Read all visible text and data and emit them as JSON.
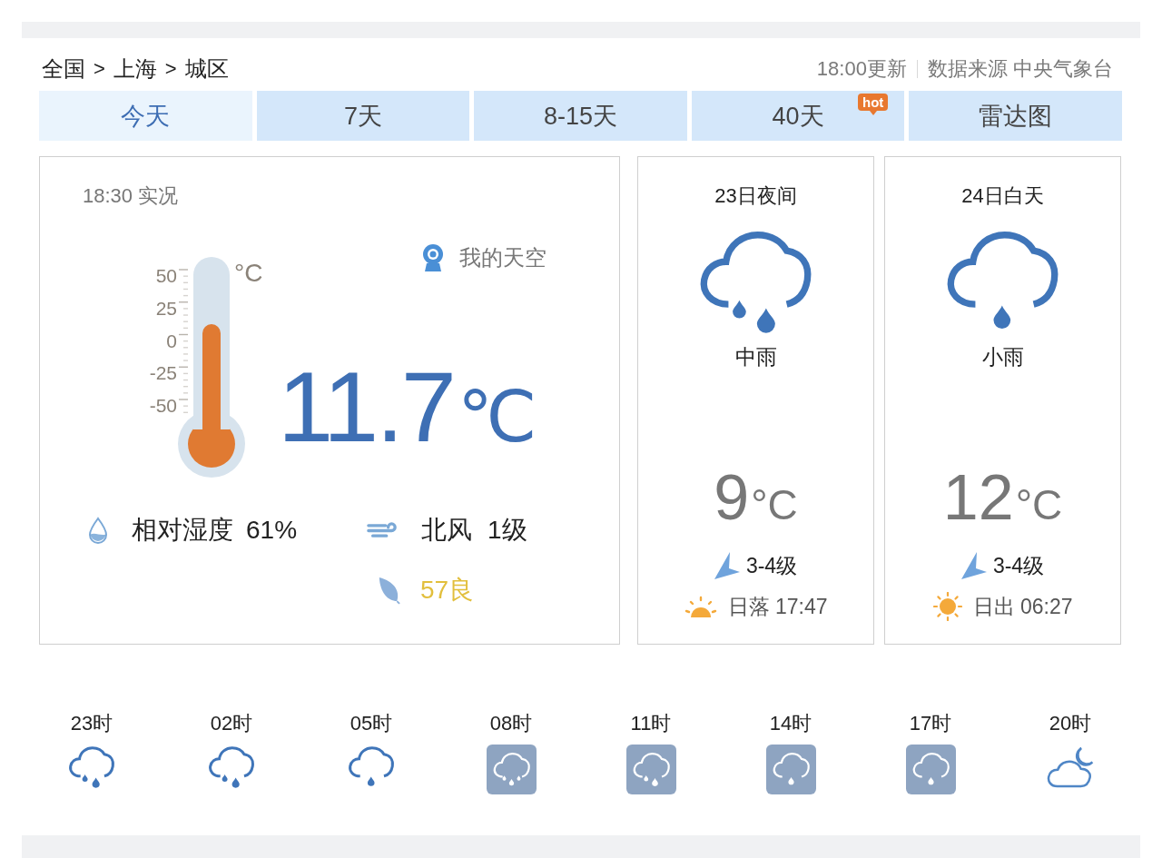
{
  "header": {
    "breadcrumb": [
      {
        "kind": "link",
        "label": "全国"
      },
      {
        "kind": "separator",
        "label": ">"
      },
      {
        "kind": "link",
        "label": "上海"
      },
      {
        "kind": "separator",
        "label": ">"
      },
      {
        "kind": "link",
        "label": "城区"
      }
    ],
    "update_time": "18:00更新",
    "source": "数据来源 中央气象台"
  },
  "tabs": [
    {
      "label": "今天",
      "selected": true
    },
    {
      "label": "7天",
      "selected": false
    },
    {
      "label": "8-15天",
      "selected": false
    },
    {
      "label": "40天",
      "selected": false,
      "badge": "hot"
    },
    {
      "label": "雷达图",
      "selected": false
    }
  ],
  "current": {
    "observed": "18:30 实况",
    "sky_link": "我的天空",
    "thermometer": {
      "scale": [
        "50",
        "25",
        "0",
        "-25",
        "-50"
      ],
      "unit": "°C",
      "level": 0.61
    },
    "temperature": "11.7",
    "unit": "℃",
    "humidity": {
      "label": "相对湿度",
      "value": "61%"
    },
    "wind": {
      "direction": "北风",
      "force": "1级"
    },
    "air_quality": "57良"
  },
  "forecast": [
    {
      "title": "23日夜间",
      "kind": "rain-moderate",
      "condition": "中雨",
      "temperature": "9",
      "unit": "°C",
      "wind": "3-4级",
      "sun": {
        "kind": "sunset",
        "text": "日落 17:47"
      }
    },
    {
      "title": "24日白天",
      "kind": "rain-light",
      "condition": "小雨",
      "temperature": "12",
      "unit": "°C",
      "wind": "3-4级",
      "sun": {
        "kind": "sunrise",
        "text": "日出 06:27"
      }
    }
  ],
  "hourly": [
    {
      "time": "23时",
      "kind": "rain-moderate",
      "tile": false
    },
    {
      "time": "02时",
      "kind": "rain-moderate",
      "tile": false
    },
    {
      "time": "05时",
      "kind": "rain-light",
      "tile": false
    },
    {
      "time": "08时",
      "kind": "rain-heavy",
      "tile": true
    },
    {
      "time": "11时",
      "kind": "rain-moderate",
      "tile": true
    },
    {
      "time": "14时",
      "kind": "rain-light",
      "tile": true
    },
    {
      "time": "17时",
      "kind": "rain-light",
      "tile": true
    },
    {
      "time": "20时",
      "kind": "cloudy-night",
      "tile": false
    }
  ]
}
